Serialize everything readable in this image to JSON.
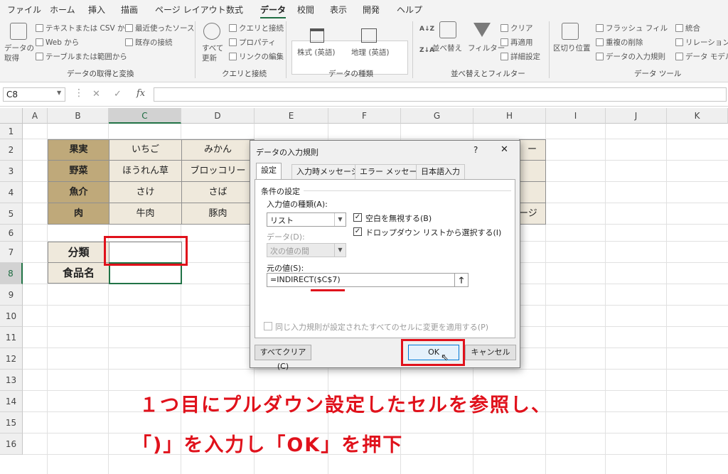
{
  "menu": {
    "tabs": [
      "ファイル",
      "ホーム",
      "挿入",
      "描画",
      "ページ レイアウト",
      "数式",
      "データ",
      "校閲",
      "表示",
      "開発",
      "ヘルプ"
    ],
    "active": "データ"
  },
  "ribbon": {
    "get_data": {
      "label_1": "データの",
      "label_2": "取得",
      "items": [
        "テキストまたは CSV から",
        "Web から",
        "テーブルまたは範囲から",
        "最近使ったソース",
        "既存の接続"
      ],
      "group": "データの取得と変換"
    },
    "queries": {
      "refresh_1": "すべて",
      "refresh_2": "更新",
      "items": [
        "クエリと接続",
        "プロパティ",
        "リンクの編集"
      ],
      "group": "クエリと接続"
    },
    "data_types": {
      "stocks": "株式 (英語)",
      "geography": "地理 (英語)",
      "group": "データの種類"
    },
    "sort_filter": {
      "sort": "並べ替え",
      "filter": "フィルター",
      "items": [
        "クリア",
        "再適用",
        "詳細設定"
      ],
      "group": "並べ替えとフィルター"
    },
    "tools": {
      "text_to_columns": "区切り位置",
      "items": [
        "フラッシュ フィル",
        "重複の削除",
        "データの入力規則",
        "統合",
        "リレーションシ",
        "データ モデル"
      ],
      "group": "データ ツール"
    }
  },
  "formula_bar": {
    "name_box": "C8",
    "fx": "fx",
    "cancel": "✕",
    "enter": "✓"
  },
  "grid": {
    "columns": [
      "A",
      "B",
      "C",
      "D",
      "E",
      "F",
      "G",
      "H",
      "I",
      "J",
      "K"
    ],
    "rows": [
      "1",
      "2",
      "3",
      "4",
      "5",
      "6",
      "7",
      "8",
      "9",
      "10",
      "11",
      "12",
      "13",
      "14",
      "15",
      "16"
    ],
    "table": [
      [
        "果実",
        "いちご",
        "みかん"
      ],
      [
        "野菜",
        "ほうれん草",
        "ブロッコリー"
      ],
      [
        "魚介",
        "さけ",
        "さば"
      ],
      [
        "肉",
        "牛肉",
        "豚肉"
      ]
    ],
    "peek_h2": "ー",
    "peek_h5": "ージ",
    "label_class": "分類",
    "label_food": "食品名"
  },
  "dialog": {
    "title": "データの入力規則",
    "help": "?",
    "close": "✕",
    "tabs": [
      "設定",
      "入力時メッセージ",
      "エラー メッセージ",
      "日本語入力"
    ],
    "section": "条件の設定",
    "allow_label": "入力値の種類(A):",
    "allow_value": "リスト",
    "ignore_blank": "空白を無視する(B)",
    "in_cell_dropdown": "ドロップダウン リストから選択する(I)",
    "data_label": "データ(D):",
    "data_value": "次の値の間",
    "source_label": "元の値(S):",
    "source_value": "=INDIRECT($C$7)",
    "apply_all": "同じ入力規則が設定されたすべてのセルに変更を適用する(P)",
    "clear_all": "すべてクリア(C)",
    "ok": "OK",
    "cancel": "キャンセル"
  },
  "caption": {
    "line1": "１つ目にプルダウン設定したセルを参照し、",
    "line2": "「)」を入力し「OK」を押下"
  },
  "colors": {
    "accent": "#217346",
    "annotation": "#e0111b",
    "category_fill": "#bfa97a",
    "item_fill": "#efe9dc"
  }
}
